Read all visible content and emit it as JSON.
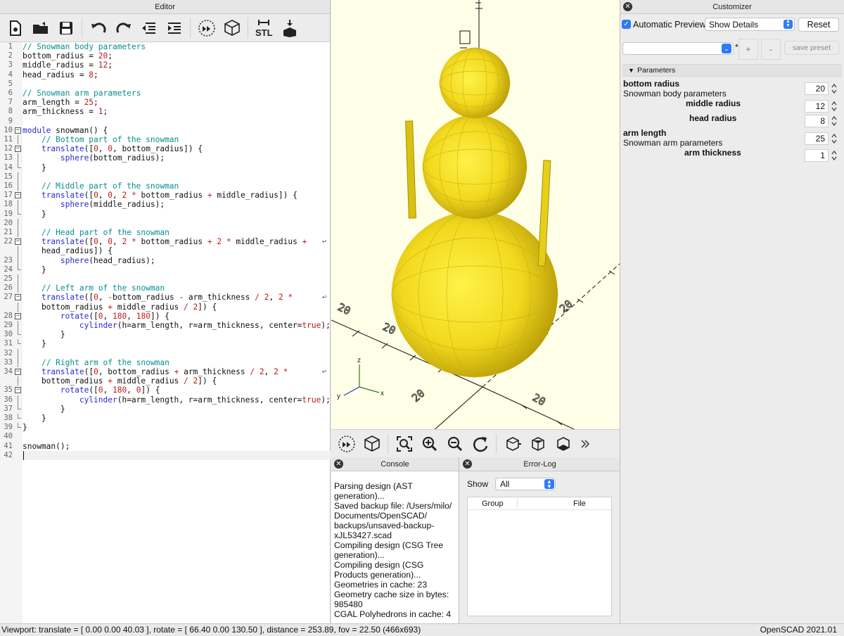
{
  "editor": {
    "title": "Editor",
    "toolbar": [
      "new-icon",
      "open-icon",
      "save-icon",
      "undo-icon",
      "redo-icon",
      "unindent-icon",
      "indent-icon",
      "preview-icon",
      "render-icon",
      "export-stl-icon",
      "send-to-printer-icon"
    ],
    "stl_label": "STL",
    "lines": [
      {
        "n": "1",
        "html": "<span class='c-com'>// Snowman body parameters</span>"
      },
      {
        "n": "2",
        "html": "bottom_radius = <span class='c-num'>20</span>;"
      },
      {
        "n": "3",
        "html": "middle_radius = <span class='c-num'>12</span>;"
      },
      {
        "n": "4",
        "html": "head_radius = <span class='c-num'>8</span>;"
      },
      {
        "n": "5",
        "html": ""
      },
      {
        "n": "6",
        "html": "<span class='c-com'>// Snowman arm parameters</span>"
      },
      {
        "n": "7",
        "html": "arm_length = <span class='c-num'>25</span>;"
      },
      {
        "n": "8",
        "html": "arm_thickness = <span class='c-num'>1</span>;"
      },
      {
        "n": "9",
        "html": ""
      },
      {
        "n": "10",
        "fold": "open",
        "html": "<span class='c-kw'>module</span> snowman() {"
      },
      {
        "n": "11",
        "fold": "line",
        "html": "    <span class='c-com'>// Bottom part of the snowman</span>"
      },
      {
        "n": "12",
        "fold": "open",
        "html": "    <span class='c-kw'>translate</span>([<span class='c-num'>0</span>, <span class='c-num'>0</span>, bottom_radius]) {"
      },
      {
        "n": "13",
        "fold": "line",
        "html": "        <span class='c-kw'>sphere</span>(bottom_radius);"
      },
      {
        "n": "14",
        "fold": "end",
        "html": "    }"
      },
      {
        "n": "15",
        "fold": "line",
        "html": ""
      },
      {
        "n": "16",
        "fold": "line",
        "html": "    <span class='c-com'>// Middle part of the snowman</span>"
      },
      {
        "n": "17",
        "fold": "open",
        "html": "    <span class='c-kw'>translate</span>([<span class='c-num'>0</span>, <span class='c-num'>0</span>, <span class='c-num'>2</span> <span class='c-op'>*</span> bottom_radius <span class='c-op'>+</span> middle_radius]) {"
      },
      {
        "n": "18",
        "fold": "line",
        "html": "        <span class='c-kw'>sphere</span>(middle_radius);"
      },
      {
        "n": "19",
        "fold": "end",
        "html": "    }"
      },
      {
        "n": "20",
        "fold": "line",
        "html": ""
      },
      {
        "n": "21",
        "fold": "line",
        "html": "    <span class='c-com'>// Head part of the snowman</span>"
      },
      {
        "n": "22",
        "fold": "open",
        "wrap": true,
        "html": "    <span class='c-kw'>translate</span>([<span class='c-num'>0</span>, <span class='c-num'>0</span>, <span class='c-num'>2</span> <span class='c-op'>*</span> bottom_radius <span class='c-op'>+</span> <span class='c-num'>2</span> <span class='c-op'>*</span> middle_radius <span class='c-op'>+</span>"
      },
      {
        "n": "",
        "fold": "line",
        "html": "    head_radius]) {"
      },
      {
        "n": "23",
        "fold": "line",
        "html": "        <span class='c-kw'>sphere</span>(head_radius);"
      },
      {
        "n": "24",
        "fold": "end",
        "html": "    }"
      },
      {
        "n": "25",
        "fold": "line",
        "html": ""
      },
      {
        "n": "26",
        "fold": "line",
        "html": "    <span class='c-com'>// Left arm of the snowman</span>"
      },
      {
        "n": "27",
        "fold": "open",
        "wrap": true,
        "html": "    <span class='c-kw'>translate</span>([<span class='c-num'>0</span>, <span class='c-op'>-</span>bottom_radius <span class='c-op'>-</span> arm_thickness <span class='c-op'>/</span> <span class='c-num'>2</span>, <span class='c-num'>2</span> <span class='c-op'>*</span>"
      },
      {
        "n": "",
        "fold": "line",
        "html": "    bottom_radius <span class='c-op'>+</span> middle_radius <span class='c-op'>/</span> <span class='c-num'>2</span>]) {"
      },
      {
        "n": "28",
        "fold": "open",
        "html": "        <span class='c-kw'>rotate</span>([<span class='c-num'>0</span>, <span class='c-num'>180</span>, <span class='c-num'>180</span>]) {"
      },
      {
        "n": "29",
        "fold": "line",
        "html": "            <span class='c-kw'>cylinder</span>(h=arm_length, r=arm_thickness, center=<span class='c-num'>true</span>);"
      },
      {
        "n": "30",
        "fold": "end",
        "html": "        }"
      },
      {
        "n": "31",
        "fold": "end",
        "html": "    }"
      },
      {
        "n": "32",
        "fold": "line",
        "html": ""
      },
      {
        "n": "33",
        "fold": "line",
        "html": "    <span class='c-com'>// Right arm of the snowman</span>"
      },
      {
        "n": "34",
        "fold": "open",
        "wrap": true,
        "html": "    <span class='c-kw'>translate</span>([<span class='c-num'>0</span>, bottom_radius <span class='c-op'>+</span> arm_thickness <span class='c-op'>/</span> <span class='c-num'>2</span>, <span class='c-num'>2</span> <span class='c-op'>*</span>"
      },
      {
        "n": "",
        "fold": "line",
        "html": "    bottom_radius <span class='c-op'>+</span> middle_radius <span class='c-op'>/</span> <span class='c-num'>2</span>]) {"
      },
      {
        "n": "35",
        "fold": "open",
        "html": "        <span class='c-kw'>rotate</span>([<span class='c-num'>0</span>, <span class='c-num'>180</span>, <span class='c-num'>0</span>]) {"
      },
      {
        "n": "36",
        "fold": "line",
        "html": "            <span class='c-kw'>cylinder</span>(h=arm_length, r=arm_thickness, center=<span class='c-num'>true</span>);"
      },
      {
        "n": "37",
        "fold": "end",
        "html": "        }"
      },
      {
        "n": "38",
        "fold": "end",
        "html": "    }"
      },
      {
        "n": "39",
        "fold": "end",
        "html": "}"
      },
      {
        "n": "40",
        "html": ""
      },
      {
        "n": "41",
        "html": "snowman();"
      },
      {
        "n": "42",
        "html": ""
      }
    ]
  },
  "viewport": {
    "axis_z": "z",
    "axis_y": "y",
    "axis_x": "x",
    "tick_labels": [
      "20",
      "20",
      "20",
      "20",
      "20"
    ],
    "toolbar": [
      "preview-icon",
      "render-icon",
      "view-all-icon",
      "zoom-in-icon",
      "zoom-out-icon",
      "reset-view-icon",
      "view-right-icon",
      "view-top-icon",
      "view-bottom-icon",
      "more-icon"
    ],
    "colors": {
      "background": "#fffee6",
      "model": "#f5df2e",
      "model_dark": "#d7bd12"
    }
  },
  "console": {
    "title": "Console",
    "lines": [
      "Parsing design (AST generation)...",
      "Saved backup file: /Users/milo/ Documents/OpenSCAD/ backups/unsaved-backup- xJL53427.scad",
      "Compiling design (CSG Tree generation)...",
      "Compiling design (CSG Products generation)...",
      "Geometries in cache: 23",
      "Geometry cache size in bytes: 985480",
      "CGAL Polyhedrons in cache: 4"
    ]
  },
  "errorlog": {
    "title": "Error-Log",
    "show_label": "Show",
    "show_value": "All",
    "columns": [
      "Group",
      "File"
    ]
  },
  "customizer": {
    "title": "Customizer",
    "auto_preview_label": "Automatic Preview",
    "auto_preview_checked": true,
    "details_value": "Show Details",
    "reset_label": "Reset",
    "preset_value": "",
    "asterisk": "*",
    "plus_label": "+",
    "minus_label": "-",
    "save_preset_label": "save preset",
    "section_label": "Parameters",
    "params": [
      {
        "name": "bottom radius",
        "desc": "Snowman body parameters",
        "value": "20"
      },
      {
        "name": "middle radius",
        "desc": "",
        "value": "12"
      },
      {
        "name": "head radius",
        "desc": "",
        "value": "8"
      },
      {
        "name": "arm length",
        "desc": "Snowman arm parameters",
        "value": "25"
      },
      {
        "name": "arm thickness",
        "desc": "",
        "value": "1"
      }
    ]
  },
  "status": {
    "viewport_text": "Viewport: translate = [ 0.00 0.00 40.03 ], rotate = [ 66.40 0.00 130.50 ], distance = 253.89, fov = 22.50 (466x693)",
    "version": "OpenSCAD 2021.01"
  }
}
